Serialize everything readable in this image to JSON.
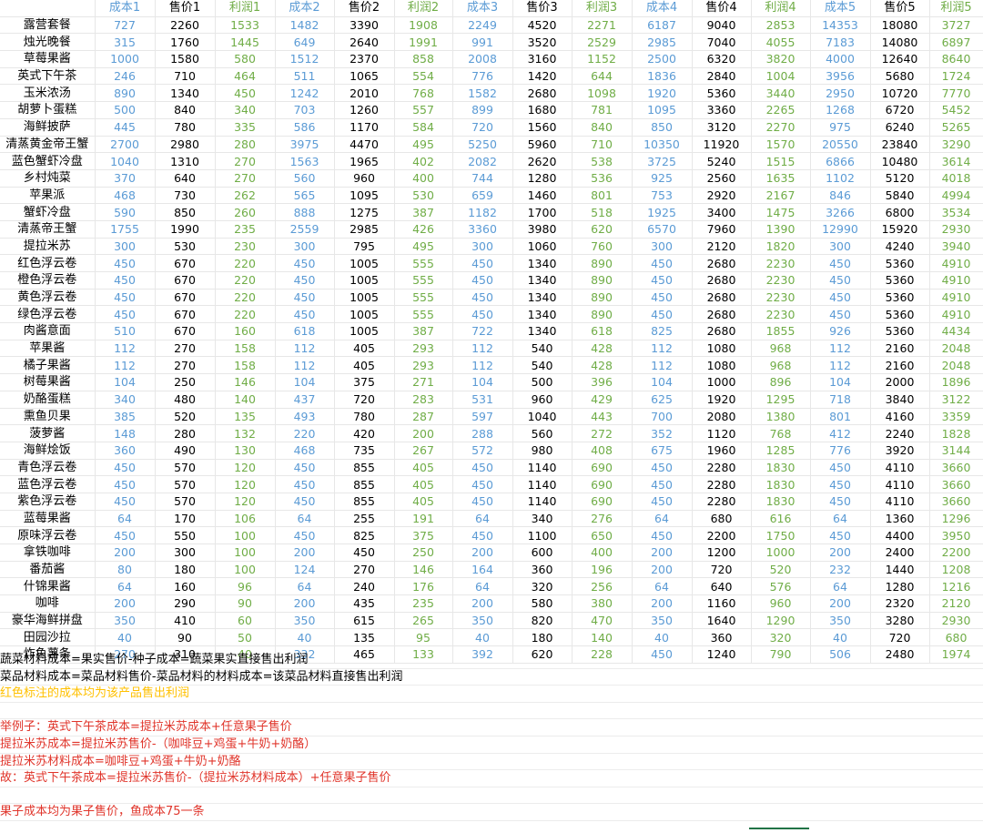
{
  "sheet": {
    "headers": [
      "",
      "成本1",
      "售价1",
      "利润1",
      "成本2",
      "售价2",
      "利润2",
      "成本3",
      "售价3",
      "利润3",
      "成本4",
      "售价4",
      "利润4",
      "成本5",
      "售价5",
      "利润5"
    ],
    "rows": [
      [
        "露营套餐",
        "727",
        "2260",
        "1533",
        "1482",
        "3390",
        "1908",
        "2249",
        "4520",
        "2271",
        "6187",
        "9040",
        "2853",
        "14353",
        "18080",
        "3727"
      ],
      [
        "烛光晚餐",
        "315",
        "1760",
        "1445",
        "649",
        "2640",
        "1991",
        "991",
        "3520",
        "2529",
        "2985",
        "7040",
        "4055",
        "7183",
        "14080",
        "6897"
      ],
      [
        "草莓果酱",
        "1000",
        "1580",
        "580",
        "1512",
        "2370",
        "858",
        "2008",
        "3160",
        "1152",
        "2500",
        "6320",
        "3820",
        "4000",
        "12640",
        "8640"
      ],
      [
        "英式下午茶",
        "246",
        "710",
        "464",
        "511",
        "1065",
        "554",
        "776",
        "1420",
        "644",
        "1836",
        "2840",
        "1004",
        "3956",
        "5680",
        "1724"
      ],
      [
        "玉米浓汤",
        "890",
        "1340",
        "450",
        "1242",
        "2010",
        "768",
        "1582",
        "2680",
        "1098",
        "1920",
        "5360",
        "3440",
        "2950",
        "10720",
        "7770"
      ],
      [
        "胡萝卜蛋糕",
        "500",
        "840",
        "340",
        "703",
        "1260",
        "557",
        "899",
        "1680",
        "781",
        "1095",
        "3360",
        "2265",
        "1268",
        "6720",
        "5452"
      ],
      [
        "海鲜披萨",
        "445",
        "780",
        "335",
        "586",
        "1170",
        "584",
        "720",
        "1560",
        "840",
        "850",
        "3120",
        "2270",
        "975",
        "6240",
        "5265"
      ],
      [
        "清蒸黄金帝王蟹",
        "2700",
        "2980",
        "280",
        "3975",
        "4470",
        "495",
        "5250",
        "5960",
        "710",
        "10350",
        "11920",
        "1570",
        "20550",
        "23840",
        "3290"
      ],
      [
        "蓝色蟹虾冷盘",
        "1040",
        "1310",
        "270",
        "1563",
        "1965",
        "402",
        "2082",
        "2620",
        "538",
        "3725",
        "5240",
        "1515",
        "6866",
        "10480",
        "3614"
      ],
      [
        "乡村炖菜",
        "370",
        "640",
        "270",
        "560",
        "960",
        "400",
        "744",
        "1280",
        "536",
        "925",
        "2560",
        "1635",
        "1102",
        "5120",
        "4018"
      ],
      [
        "苹果派",
        "468",
        "730",
        "262",
        "565",
        "1095",
        "530",
        "659",
        "1460",
        "801",
        "753",
        "2920",
        "2167",
        "846",
        "5840",
        "4994"
      ],
      [
        "蟹虾冷盘",
        "590",
        "850",
        "260",
        "888",
        "1275",
        "387",
        "1182",
        "1700",
        "518",
        "1925",
        "3400",
        "1475",
        "3266",
        "6800",
        "3534"
      ],
      [
        "清蒸帝王蟹",
        "1755",
        "1990",
        "235",
        "2559",
        "2985",
        "426",
        "3360",
        "3980",
        "620",
        "6570",
        "7960",
        "1390",
        "12990",
        "15920",
        "2930"
      ],
      [
        "提拉米苏",
        "300",
        "530",
        "230",
        "300",
        "795",
        "495",
        "300",
        "1060",
        "760",
        "300",
        "2120",
        "1820",
        "300",
        "4240",
        "3940"
      ],
      [
        "红色浮云卷",
        "450",
        "670",
        "220",
        "450",
        "1005",
        "555",
        "450",
        "1340",
        "890",
        "450",
        "2680",
        "2230",
        "450",
        "5360",
        "4910"
      ],
      [
        "橙色浮云卷",
        "450",
        "670",
        "220",
        "450",
        "1005",
        "555",
        "450",
        "1340",
        "890",
        "450",
        "2680",
        "2230",
        "450",
        "5360",
        "4910"
      ],
      [
        "黄色浮云卷",
        "450",
        "670",
        "220",
        "450",
        "1005",
        "555",
        "450",
        "1340",
        "890",
        "450",
        "2680",
        "2230",
        "450",
        "5360",
        "4910"
      ],
      [
        "绿色浮云卷",
        "450",
        "670",
        "220",
        "450",
        "1005",
        "555",
        "450",
        "1340",
        "890",
        "450",
        "2680",
        "2230",
        "450",
        "5360",
        "4910"
      ],
      [
        "肉酱意面",
        "510",
        "670",
        "160",
        "618",
        "1005",
        "387",
        "722",
        "1340",
        "618",
        "825",
        "2680",
        "1855",
        "926",
        "5360",
        "4434"
      ],
      [
        "苹果酱",
        "112",
        "270",
        "158",
        "112",
        "405",
        "293",
        "112",
        "540",
        "428",
        "112",
        "1080",
        "968",
        "112",
        "2160",
        "2048"
      ],
      [
        "橘子果酱",
        "112",
        "270",
        "158",
        "112",
        "405",
        "293",
        "112",
        "540",
        "428",
        "112",
        "1080",
        "968",
        "112",
        "2160",
        "2048"
      ],
      [
        "树莓果酱",
        "104",
        "250",
        "146",
        "104",
        "375",
        "271",
        "104",
        "500",
        "396",
        "104",
        "1000",
        "896",
        "104",
        "2000",
        "1896"
      ],
      [
        "奶酪蛋糕",
        "340",
        "480",
        "140",
        "437",
        "720",
        "283",
        "531",
        "960",
        "429",
        "625",
        "1920",
        "1295",
        "718",
        "3840",
        "3122"
      ],
      [
        "熏鱼贝果",
        "385",
        "520",
        "135",
        "493",
        "780",
        "287",
        "597",
        "1040",
        "443",
        "700",
        "2080",
        "1380",
        "801",
        "4160",
        "3359"
      ],
      [
        "菠萝酱",
        "148",
        "280",
        "132",
        "220",
        "420",
        "200",
        "288",
        "560",
        "272",
        "352",
        "1120",
        "768",
        "412",
        "2240",
        "1828"
      ],
      [
        "海鲜烩饭",
        "360",
        "490",
        "130",
        "468",
        "735",
        "267",
        "572",
        "980",
        "408",
        "675",
        "1960",
        "1285",
        "776",
        "3920",
        "3144"
      ],
      [
        "青色浮云卷",
        "450",
        "570",
        "120",
        "450",
        "855",
        "405",
        "450",
        "1140",
        "690",
        "450",
        "2280",
        "1830",
        "450",
        "4110",
        "3660"
      ],
      [
        "蓝色浮云卷",
        "450",
        "570",
        "120",
        "450",
        "855",
        "405",
        "450",
        "1140",
        "690",
        "450",
        "2280",
        "1830",
        "450",
        "4110",
        "3660"
      ],
      [
        "紫色浮云卷",
        "450",
        "570",
        "120",
        "450",
        "855",
        "405",
        "450",
        "1140",
        "690",
        "450",
        "2280",
        "1830",
        "450",
        "4110",
        "3660"
      ],
      [
        "蓝莓果酱",
        "64",
        "170",
        "106",
        "64",
        "255",
        "191",
        "64",
        "340",
        "276",
        "64",
        "680",
        "616",
        "64",
        "1360",
        "1296"
      ],
      [
        "原味浮云卷",
        "450",
        "550",
        "100",
        "450",
        "825",
        "375",
        "450",
        "1100",
        "650",
        "450",
        "2200",
        "1750",
        "450",
        "4400",
        "3950"
      ],
      [
        "拿铁咖啡",
        "200",
        "300",
        "100",
        "200",
        "450",
        "250",
        "200",
        "600",
        "400",
        "200",
        "1200",
        "1000",
        "200",
        "2400",
        "2200"
      ],
      [
        "番茄酱",
        "80",
        "180",
        "100",
        "124",
        "270",
        "146",
        "164",
        "360",
        "196",
        "200",
        "720",
        "520",
        "232",
        "1440",
        "1208"
      ],
      [
        "什锦果酱",
        "64",
        "160",
        "96",
        "64",
        "240",
        "176",
        "64",
        "320",
        "256",
        "64",
        "640",
        "576",
        "64",
        "1280",
        "1216"
      ],
      [
        "咖啡",
        "200",
        "290",
        "90",
        "200",
        "435",
        "235",
        "200",
        "580",
        "380",
        "200",
        "1160",
        "960",
        "200",
        "2320",
        "2120"
      ],
      [
        "豪华海鲜拼盘",
        "350",
        "410",
        "60",
        "350",
        "615",
        "265",
        "350",
        "820",
        "470",
        "350",
        "1640",
        "1290",
        "350",
        "3280",
        "2930"
      ],
      [
        "田园沙拉",
        "40",
        "90",
        "50",
        "40",
        "135",
        "95",
        "40",
        "180",
        "140",
        "40",
        "360",
        "320",
        "40",
        "720",
        "680"
      ],
      [
        "炸鱼薯条",
        "270",
        "310",
        "40",
        "332",
        "465",
        "133",
        "392",
        "620",
        "228",
        "450",
        "1240",
        "790",
        "506",
        "2480",
        "1974"
      ]
    ]
  },
  "notes": [
    {
      "text": "蔬菜材料成本=果实售价-种子成本=蔬菜果实直接售出利润",
      "color": "#000000"
    },
    {
      "text": "菜品材料成本=菜品材料售价-菜品材料的材料成本=该菜品材料直接售出利润",
      "color": "#000000"
    },
    {
      "text": "红色标注的成本均为该产品售出利润",
      "color": "#ffc000"
    },
    {
      "text": "",
      "color": "#000000"
    },
    {
      "text": "举例子：英式下午茶成本=提拉米苏成本+任意果子售价",
      "color": "#e0352b"
    },
    {
      "text": "提拉米苏成本=提拉米苏售价-（咖啡豆+鸡蛋+牛奶+奶酪）",
      "color": "#e0352b"
    },
    {
      "text": "提拉米苏材料成本=咖啡豆+鸡蛋+牛奶+奶酪",
      "color": "#e0352b"
    },
    {
      "text": "故：英式下午茶成本=提拉米苏售价-（提拉米苏材料成本）+任意果子售价",
      "color": "#e0352b"
    },
    {
      "text": "",
      "color": "#000000"
    },
    {
      "text": "果子成本均为果子售价，鱼成本75一条",
      "color": "#e0352b"
    }
  ],
  "colors": {
    "cost": "#5b9bd5",
    "price": "#000000",
    "profit": "#70ad47"
  }
}
